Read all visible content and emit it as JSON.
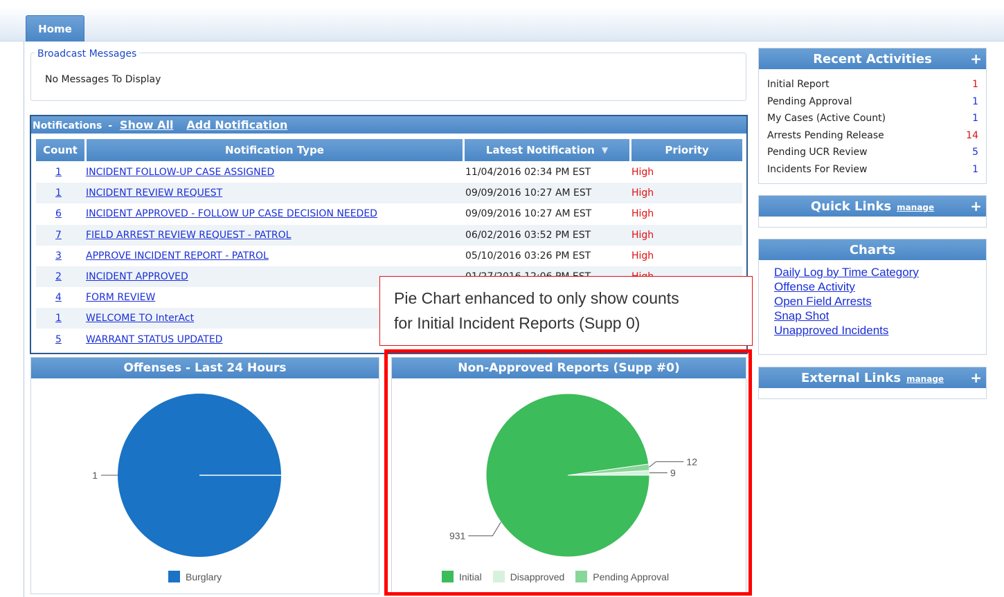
{
  "tabs": {
    "home": "Home"
  },
  "broadcast": {
    "title": "Broadcast Messages",
    "message": "No Messages To Display"
  },
  "notifications": {
    "title": "Notifications",
    "separator": "-",
    "show_all": "Show All",
    "add": "Add Notification",
    "columns": [
      "Count",
      "Notification Type",
      "Latest Notification",
      "Priority"
    ],
    "rows": [
      {
        "count": "1",
        "type": "INCIDENT FOLLOW-UP CASE ASSIGNED",
        "latest": "11/04/2016 02:34 PM EST",
        "priority": "High"
      },
      {
        "count": "1",
        "type": "INCIDENT REVIEW REQUEST",
        "latest": "09/09/2016 10:27 AM EST",
        "priority": "High"
      },
      {
        "count": "6",
        "type": "INCIDENT APPROVED - FOLLOW UP CASE DECISION NEEDED",
        "latest": "09/09/2016 10:27 AM EST",
        "priority": "High"
      },
      {
        "count": "7",
        "type": "FIELD ARREST REVIEW REQUEST - PATROL",
        "latest": "06/02/2016 03:52 PM EST",
        "priority": "High"
      },
      {
        "count": "3",
        "type": "APPROVE INCIDENT REPORT - PATROL",
        "latest": "05/10/2016 03:26 PM EST",
        "priority": "High"
      },
      {
        "count": "2",
        "type": "INCIDENT APPROVED",
        "latest": "01/27/2016 12:06 PM EST",
        "priority": "High"
      },
      {
        "count": "4",
        "type": "FORM REVIEW",
        "latest": "",
        "priority": ""
      },
      {
        "count": "1",
        "type": "WELCOME TO InterAct",
        "latest": "",
        "priority": ""
      },
      {
        "count": "5",
        "type": "WARRANT STATUS UPDATED",
        "latest": "",
        "priority": ""
      }
    ]
  },
  "callout": {
    "line1": "Pie Chart enhanced to only show counts",
    "line2": "for Initial Incident Reports (Supp 0)"
  },
  "chart_data": [
    {
      "type": "pie",
      "title": "Offenses - Last 24 Hours",
      "slices": [
        {
          "label": "Burglary",
          "value": 1,
          "color": "#1a73c4"
        }
      ],
      "data_labels": [
        "1"
      ],
      "legend": "bottom"
    },
    {
      "type": "pie",
      "title": "Non-Approved Reports (Supp #0)",
      "slices": [
        {
          "label": "Initial",
          "value": 931,
          "color": "#3cbc5a"
        },
        {
          "label": "Disapproved",
          "value": 9,
          "color": "#d6f2dc"
        },
        {
          "label": "Pending Approval",
          "value": 12,
          "color": "#88d69a"
        }
      ],
      "legend": "bottom"
    }
  ],
  "recent_activities": {
    "title": "Recent Activities",
    "plus": "+",
    "items": [
      {
        "label": "Initial Report",
        "count": "1",
        "color": "red"
      },
      {
        "label": "Pending Approval",
        "count": "1",
        "color": "blue"
      },
      {
        "label": "My Cases (Active Count)",
        "count": "1",
        "color": "blue"
      },
      {
        "label": "Arrests Pending Release",
        "count": "14",
        "color": "red"
      },
      {
        "label": "Pending UCR Review",
        "count": "5",
        "color": "blue"
      },
      {
        "label": "Incidents For Review",
        "count": "1",
        "color": "blue"
      }
    ]
  },
  "quick_links": {
    "title": "Quick Links",
    "manage": "manage",
    "plus": "+"
  },
  "charts_panel": {
    "title": "Charts",
    "links": [
      "Daily Log by Time Category",
      "Offense Activity",
      "Open Field Arrests",
      "Snap Shot",
      "Unapproved Incidents"
    ]
  },
  "external_links": {
    "title": "External Links",
    "manage": "manage",
    "plus": "+"
  },
  "colors": {
    "header_blue": "#4b87c6",
    "link": "#1a2fd6",
    "priority_high": "#e01010",
    "highlight": "#ff0000"
  }
}
